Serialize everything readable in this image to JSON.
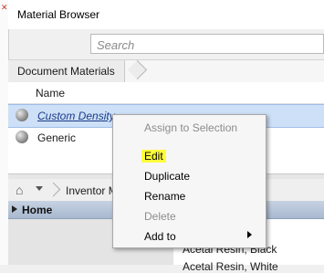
{
  "window": {
    "title": "Material Browser"
  },
  "search": {
    "placeholder": "Search"
  },
  "breadcrumb": {
    "label": "Document Materials"
  },
  "columns": {
    "name": "Name"
  },
  "materials": [
    {
      "name": "Custom Density",
      "selected": true
    },
    {
      "name": "Generic",
      "selected": false
    }
  ],
  "library_bar": {
    "label": "Inventor M"
  },
  "tree": {
    "home_label": "Home"
  },
  "library_items": [
    "Acetal Resin, Black",
    "Acetal Resin, White"
  ],
  "context_menu": {
    "assign_to_selection": "Assign to Selection",
    "edit": "Edit",
    "duplicate": "Duplicate",
    "rename": "Rename",
    "delete": "Delete",
    "add_to": "Add to"
  },
  "colors": {
    "selection": "#cde0f7",
    "highlight": "#fffd3a",
    "tree_header": "#b6c4d8"
  },
  "icons": [
    "home-icon",
    "dropdown-arrow-icon",
    "expand-triangle-icon",
    "material-sphere-icon",
    "submenu-arrow-icon"
  ]
}
